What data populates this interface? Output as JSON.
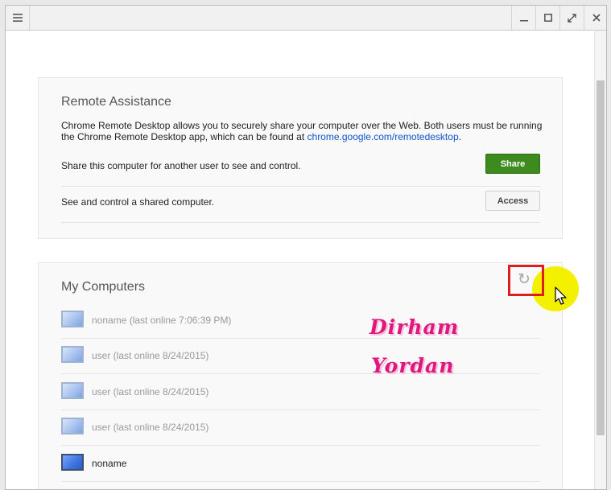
{
  "titlebar": {
    "menu_icon": "menu-icon",
    "controls": [
      "minimize-icon",
      "maximize-icon",
      "fullscreen-icon",
      "close-icon"
    ]
  },
  "remote_assistance": {
    "title": "Remote Assistance",
    "description_prefix": "Chrome Remote Desktop allows you to securely share your computer over the Web. Both users must be running the Chrome Remote Desktop app, which can be found at ",
    "description_link": "chrome.google.com/remotedesktop",
    "description_suffix": ".",
    "share_label": "Share this computer for another user to see and control.",
    "share_button": "Share",
    "access_label": "See and control a shared computer.",
    "access_button": "Access"
  },
  "my_computers": {
    "title": "My Computers",
    "refresh_icon": "refresh-icon",
    "items": [
      {
        "label": "noname (last online 7:06:39 PM)",
        "online": false
      },
      {
        "label": "user (last online 8/24/2015)",
        "online": false
      },
      {
        "label": "user (last online 8/24/2015)",
        "online": false
      },
      {
        "label": "user (last online 8/24/2015)",
        "online": false
      },
      {
        "label": "noname",
        "online": true
      }
    ]
  },
  "watermark": {
    "line1": "Dirham",
    "line2": "Yordan"
  },
  "colors": {
    "share_button": "#3d8b1f",
    "link": "#1155cc",
    "highlight_box": "#dd1f1f",
    "cursor_halo": "#f3f100",
    "watermark": "#e0187d"
  }
}
